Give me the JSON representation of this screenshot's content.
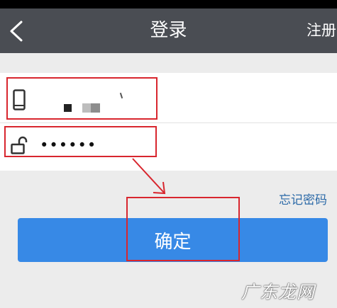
{
  "header": {
    "back_icon": "chevron-left-icon",
    "title": "登录",
    "register_label": "注册"
  },
  "form": {
    "phone_icon": "mobile-phone-icon",
    "password_icon": "unlock-icon",
    "password_value": "••••••"
  },
  "forgot_label": "忘记密码",
  "confirm_label": "确定",
  "watermark_text": "广东龙网",
  "colors": {
    "navbar": "#4a4d53",
    "button": "#3789e6",
    "link": "#2c6aa8",
    "annotation": "#d8262e"
  }
}
